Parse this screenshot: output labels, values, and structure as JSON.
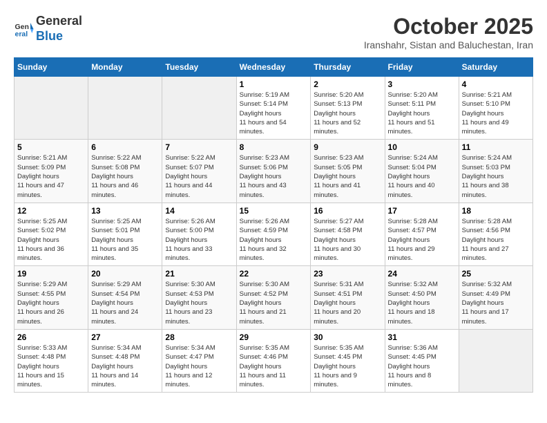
{
  "header": {
    "logo_line1": "General",
    "logo_line2": "Blue",
    "month": "October 2025",
    "location": "Iranshahr, Sistan and Baluchestan, Iran"
  },
  "weekdays": [
    "Sunday",
    "Monday",
    "Tuesday",
    "Wednesday",
    "Thursday",
    "Friday",
    "Saturday"
  ],
  "weeks": [
    [
      {
        "day": "",
        "empty": true
      },
      {
        "day": "",
        "empty": true
      },
      {
        "day": "",
        "empty": true
      },
      {
        "day": "1",
        "sunrise": "5:19 AM",
        "sunset": "5:14 PM",
        "daylight": "11 hours and 54 minutes."
      },
      {
        "day": "2",
        "sunrise": "5:20 AM",
        "sunset": "5:13 PM",
        "daylight": "11 hours and 52 minutes."
      },
      {
        "day": "3",
        "sunrise": "5:20 AM",
        "sunset": "5:11 PM",
        "daylight": "11 hours and 51 minutes."
      },
      {
        "day": "4",
        "sunrise": "5:21 AM",
        "sunset": "5:10 PM",
        "daylight": "11 hours and 49 minutes."
      }
    ],
    [
      {
        "day": "5",
        "sunrise": "5:21 AM",
        "sunset": "5:09 PM",
        "daylight": "11 hours and 47 minutes."
      },
      {
        "day": "6",
        "sunrise": "5:22 AM",
        "sunset": "5:08 PM",
        "daylight": "11 hours and 46 minutes."
      },
      {
        "day": "7",
        "sunrise": "5:22 AM",
        "sunset": "5:07 PM",
        "daylight": "11 hours and 44 minutes."
      },
      {
        "day": "8",
        "sunrise": "5:23 AM",
        "sunset": "5:06 PM",
        "daylight": "11 hours and 43 minutes."
      },
      {
        "day": "9",
        "sunrise": "5:23 AM",
        "sunset": "5:05 PM",
        "daylight": "11 hours and 41 minutes."
      },
      {
        "day": "10",
        "sunrise": "5:24 AM",
        "sunset": "5:04 PM",
        "daylight": "11 hours and 40 minutes."
      },
      {
        "day": "11",
        "sunrise": "5:24 AM",
        "sunset": "5:03 PM",
        "daylight": "11 hours and 38 minutes."
      }
    ],
    [
      {
        "day": "12",
        "sunrise": "5:25 AM",
        "sunset": "5:02 PM",
        "daylight": "11 hours and 36 minutes."
      },
      {
        "day": "13",
        "sunrise": "5:25 AM",
        "sunset": "5:01 PM",
        "daylight": "11 hours and 35 minutes."
      },
      {
        "day": "14",
        "sunrise": "5:26 AM",
        "sunset": "5:00 PM",
        "daylight": "11 hours and 33 minutes."
      },
      {
        "day": "15",
        "sunrise": "5:26 AM",
        "sunset": "4:59 PM",
        "daylight": "11 hours and 32 minutes."
      },
      {
        "day": "16",
        "sunrise": "5:27 AM",
        "sunset": "4:58 PM",
        "daylight": "11 hours and 30 minutes."
      },
      {
        "day": "17",
        "sunrise": "5:28 AM",
        "sunset": "4:57 PM",
        "daylight": "11 hours and 29 minutes."
      },
      {
        "day": "18",
        "sunrise": "5:28 AM",
        "sunset": "4:56 PM",
        "daylight": "11 hours and 27 minutes."
      }
    ],
    [
      {
        "day": "19",
        "sunrise": "5:29 AM",
        "sunset": "4:55 PM",
        "daylight": "11 hours and 26 minutes."
      },
      {
        "day": "20",
        "sunrise": "5:29 AM",
        "sunset": "4:54 PM",
        "daylight": "11 hours and 24 minutes."
      },
      {
        "day": "21",
        "sunrise": "5:30 AM",
        "sunset": "4:53 PM",
        "daylight": "11 hours and 23 minutes."
      },
      {
        "day": "22",
        "sunrise": "5:30 AM",
        "sunset": "4:52 PM",
        "daylight": "11 hours and 21 minutes."
      },
      {
        "day": "23",
        "sunrise": "5:31 AM",
        "sunset": "4:51 PM",
        "daylight": "11 hours and 20 minutes."
      },
      {
        "day": "24",
        "sunrise": "5:32 AM",
        "sunset": "4:50 PM",
        "daylight": "11 hours and 18 minutes."
      },
      {
        "day": "25",
        "sunrise": "5:32 AM",
        "sunset": "4:49 PM",
        "daylight": "11 hours and 17 minutes."
      }
    ],
    [
      {
        "day": "26",
        "sunrise": "5:33 AM",
        "sunset": "4:48 PM",
        "daylight": "11 hours and 15 minutes."
      },
      {
        "day": "27",
        "sunrise": "5:34 AM",
        "sunset": "4:48 PM",
        "daylight": "11 hours and 14 minutes."
      },
      {
        "day": "28",
        "sunrise": "5:34 AM",
        "sunset": "4:47 PM",
        "daylight": "11 hours and 12 minutes."
      },
      {
        "day": "29",
        "sunrise": "5:35 AM",
        "sunset": "4:46 PM",
        "daylight": "11 hours and 11 minutes."
      },
      {
        "day": "30",
        "sunrise": "5:35 AM",
        "sunset": "4:45 PM",
        "daylight": "11 hours and 9 minutes."
      },
      {
        "day": "31",
        "sunrise": "5:36 AM",
        "sunset": "4:45 PM",
        "daylight": "11 hours and 8 minutes."
      },
      {
        "day": "",
        "empty": true
      }
    ]
  ],
  "labels": {
    "sunrise": "Sunrise:",
    "sunset": "Sunset:",
    "daylight": "Daylight hours"
  }
}
